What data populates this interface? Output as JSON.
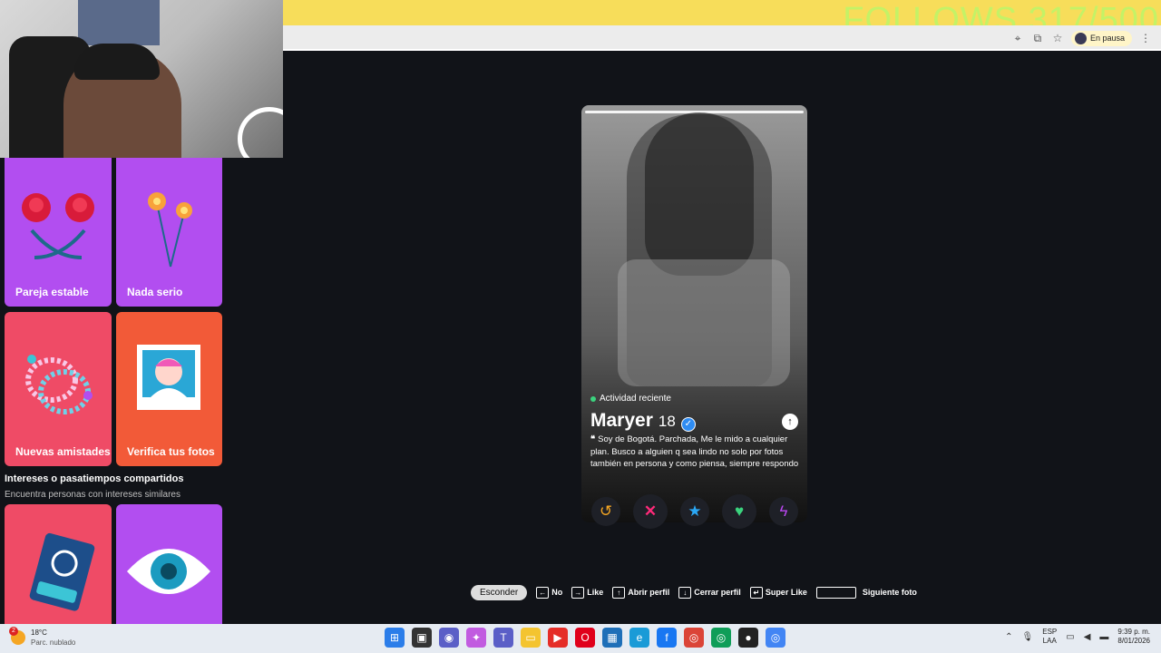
{
  "overlay": {
    "follows_text": "FOLLOWS 317/500"
  },
  "browser": {
    "profile_status": "En pausa",
    "icons": [
      "location-icon",
      "install-icon",
      "star-icon",
      "menu-icon"
    ]
  },
  "sidebar": {
    "tiles": [
      {
        "label": "Pareja estable",
        "icon": "roses-icon"
      },
      {
        "label": "Nada serio",
        "icon": "sparklers-icon"
      },
      {
        "label": "Nuevas amistades",
        "icon": "bracelets-icon"
      },
      {
        "label": "Verifica tus fotos",
        "icon": "portrait-icon"
      },
      {
        "label": "",
        "icon": "passport-icon"
      },
      {
        "label": "",
        "icon": "eye-icon"
      }
    ],
    "section_title": "Intereses o pasatiempos compartidos",
    "section_subtitle": "Encuentra personas con intereses similares"
  },
  "profile": {
    "activity": "Actividad reciente",
    "name": "Maryer",
    "age": "18",
    "bio": "Soy de Bogotá. Parchada, Me le mido a cualquier plan. Busco a alguien q sea lindo no solo por fotos también en persona y como piensa, siempre respondo"
  },
  "actions": {
    "rewind": "↺",
    "nope": "✕",
    "super_like": "★",
    "like": "♥",
    "boost": "ϟ"
  },
  "shortcuts": {
    "hide": "Esconder",
    "no": "No",
    "like": "Like",
    "open_profile": "Abrir perfil",
    "close_profile": "Cerrar perfil",
    "super_like": "Super Like",
    "next_photo": "Siguiente foto"
  },
  "taskbar": {
    "weather_badge": "2",
    "temperature": "18°C",
    "weather_desc": "Parc. nublado",
    "lang_top": "ESP",
    "lang_bottom": "LAA",
    "time": "9:39 p. m.",
    "date": "8/01/2026"
  },
  "colors": {
    "topbar": "#f7dd5a",
    "tile_purple": "#b24ef0",
    "tile_pink": "#ef4b66",
    "tile_orange": "#f25a38",
    "nope": "#ff2a7a",
    "like": "#3bd37e",
    "super": "#2aa7f5",
    "rewind": "#f5a623",
    "boost": "#b946f0"
  }
}
